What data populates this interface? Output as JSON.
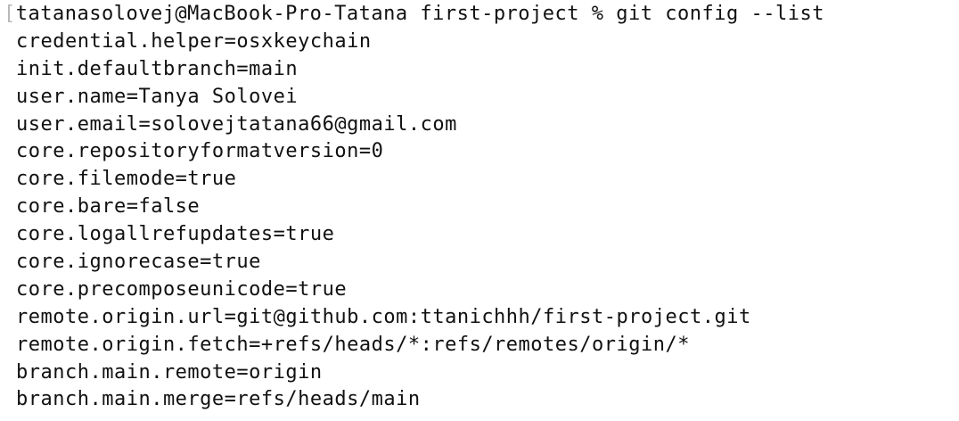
{
  "terminal": {
    "prompt": {
      "bracket": "[",
      "user_host": "tatanasolovej@MacBook-Pro-Tatana",
      "directory": "first-project",
      "symbol": "%",
      "command": "git config --list"
    },
    "output": [
      "credential.helper=osxkeychain",
      "init.defaultbranch=main",
      "user.name=Tanya Solovei",
      "user.email=solovejtatana66@gmail.com",
      "core.repositoryformatversion=0",
      "core.filemode=true",
      "core.bare=false",
      "core.logallrefupdates=true",
      "core.ignorecase=true",
      "core.precomposeunicode=true",
      "remote.origin.url=git@github.com:ttanichhh/first-project.git",
      "remote.origin.fetch=+refs/heads/*:refs/remotes/origin/*",
      "branch.main.remote=origin",
      "branch.main.merge=refs/heads/main"
    ]
  }
}
